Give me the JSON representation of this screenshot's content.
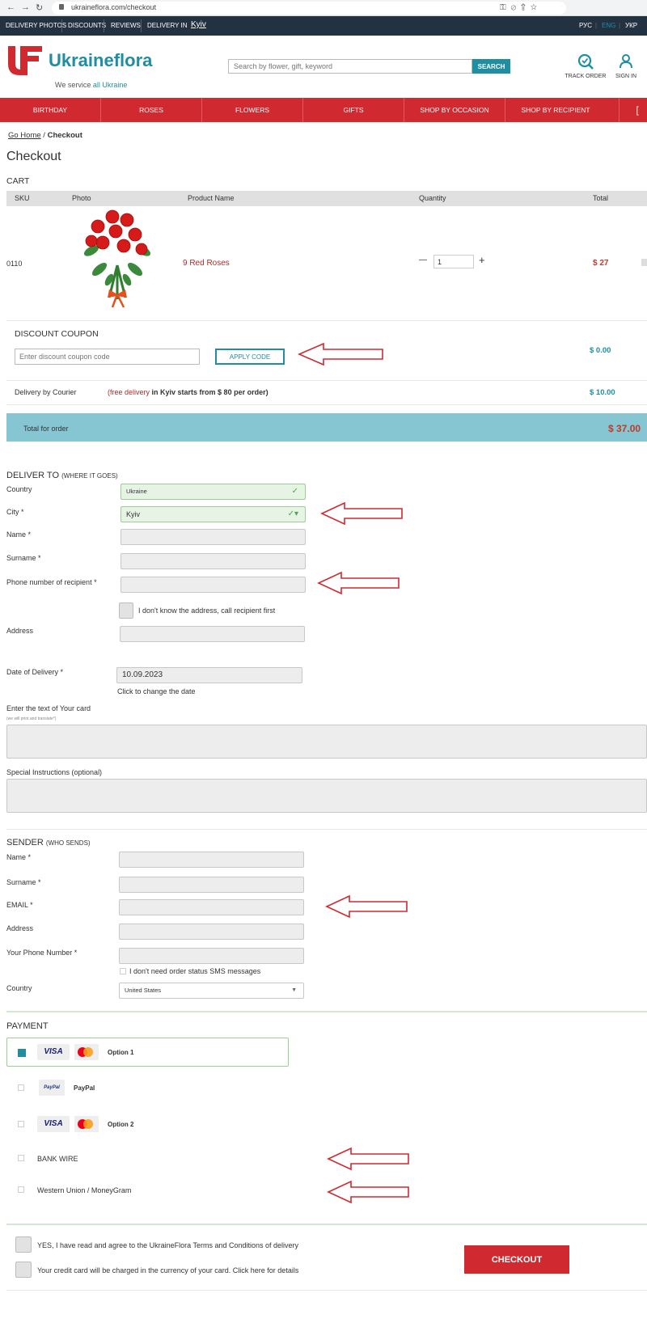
{
  "browser": {
    "url": "ukraineflora.com/checkout"
  },
  "topbar": {
    "links": [
      "DELIVERY PHOTOS",
      "DISCOUNTS",
      "REVIEWS",
      "DELIVERY IN"
    ],
    "city": "Kyiv",
    "languages": [
      "РУС",
      "ENG",
      "УКР"
    ]
  },
  "header": {
    "logo_text": "Ukraineflora",
    "subline_prefix": "We service",
    "subline_link": "all Ukraine",
    "search_placeholder": "Search by flower, gift, keyword",
    "search_button": "SEARCH",
    "track_order": "TRACK ORDER",
    "sign_in": "SIGN IN"
  },
  "nav": [
    "BIRTHDAY",
    "ROSES",
    "FLOWERS",
    "GIFTS",
    "SHOP BY OCCASION",
    "SHOP BY RECIPIENT"
  ],
  "breadcrumb": {
    "home": "Go Home",
    "separator": "/",
    "current": "Checkout"
  },
  "page_title": "Checkout",
  "cart": {
    "title": "CART",
    "columns": [
      "SKU",
      "Photo",
      "Product Name",
      "Quantity",
      "Total"
    ],
    "item": {
      "sku": "0110",
      "name": "9 Red Roses",
      "quantity": "1",
      "total": "$ 27",
      "minus": "—",
      "plus": "+"
    }
  },
  "discount": {
    "title": "DISCOUNT COUPON",
    "placeholder": "Enter discount coupon code",
    "apply": "APPLY CODE",
    "amount": "$ 0.00"
  },
  "delivery": {
    "label": "Delivery by Courier",
    "note_open": "(",
    "note_free": "free delivery",
    "note_rest": " in Kyiv starts from $ 80 per order)",
    "amount": "$ 10.00"
  },
  "total": {
    "label": "Total for order",
    "amount": "$ 37.00"
  },
  "deliver_to": {
    "title": "DELIVER TO",
    "subtitle": "(WHERE IT GOES)",
    "country_label": "Country",
    "country_value": "Ukraine",
    "city_label": "City *",
    "city_value": "Kyiv",
    "name_label": "Name *",
    "surname_label": "Surname *",
    "phone_label": "Phone number of recipient *",
    "unknown_address": "I don't know the address, call recipient first",
    "address_label": "Address",
    "date_label": "Date of Delivery *",
    "date_value": "10.09.2023",
    "date_hint": "Click to change the date",
    "card_label": "Enter the text of Your card",
    "card_hint": "(we will print and translate*)",
    "special_label": "Special Instructions (optional)"
  },
  "sender": {
    "title": "SENDER",
    "subtitle": "(WHO SENDS)",
    "name_label": "Name *",
    "surname_label": "Surname *",
    "email_label": "EMAIL *",
    "address_label": "Address",
    "phone_label": "Your Phone Number *",
    "sms_label": "I don't need order status SMS messages",
    "country_label": "Country",
    "country_value": "United States"
  },
  "payment": {
    "title": "PAYMENT",
    "options": [
      {
        "name": "Option 1",
        "visa": "VISA"
      },
      {
        "name": "PayPal",
        "badge": "PayPal"
      },
      {
        "name": "Option 2",
        "visa": "VISA"
      },
      {
        "name": "BANK WIRE"
      },
      {
        "name": "Western Union / MoneyGram"
      }
    ]
  },
  "footer": {
    "agree": "YES, I have  read and agree to the UkraineFlora Terms and Conditions of delivery",
    "charge": "Your credit card will be charged in the currency of your card.   Click here for details",
    "checkout": "CHECKOUT"
  },
  "colors": {
    "teal": "#1f8ea0",
    "red": "#d02a30",
    "total_bar": "#86c6d2",
    "dark": "#233241"
  }
}
